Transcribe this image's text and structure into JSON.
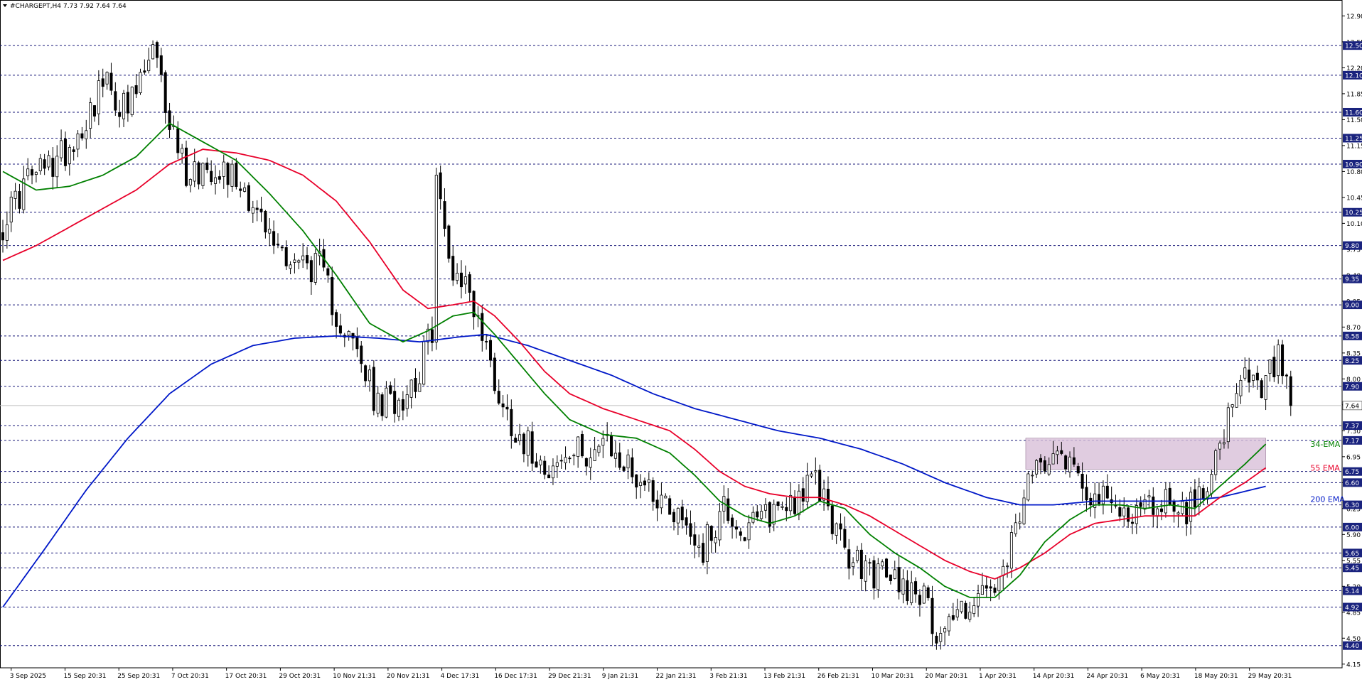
{
  "header": {
    "symbol": "#CHARGEPT,H4",
    "ohlc": "7.73 7.92 7.64 7.64",
    "arrow": "triangle-down-icon"
  },
  "colors": {
    "candle": "#000000",
    "ema34": "#008000",
    "ema55": "#e8002a",
    "ema200": "#0018c8",
    "level_line": "#1a1a7a",
    "level_tag_bg": "#1a237e",
    "level_tag_text": "#ffffff",
    "zone_fill": "#d8bfd8",
    "zone_border": "#8a6a8a",
    "current_price_line": "#c0c0c0"
  },
  "chart_data": {
    "type": "candlestick",
    "title": "#CHARGEPT,H4",
    "ylim": [
      4.1,
      13.0
    ],
    "grid": false,
    "price_ticks": [
      "12.90",
      "12.55",
      "12.20",
      "11.85",
      "11.50",
      "11.15",
      "10.80",
      "10.45",
      "10.10",
      "9.75",
      "9.40",
      "9.05",
      "8.70",
      "8.35",
      "8.00",
      "7.65",
      "7.30",
      "6.95",
      "6.60",
      "6.25",
      "5.90",
      "5.55",
      "5.20",
      "4.85",
      "4.50",
      "4.15"
    ],
    "levels": [
      "12.50",
      "12.10",
      "11.60",
      "11.25",
      "10.90",
      "10.25",
      "9.80",
      "9.35",
      "9.00",
      "8.58",
      "8.25",
      "7.90",
      "7.37",
      "7.17",
      "6.75",
      "6.60",
      "6.30",
      "6.00",
      "5.65",
      "5.45",
      "5.14",
      "4.92",
      "4.40"
    ],
    "current_price": "7.64",
    "x_labels": [
      "3 Sep 2025",
      "15 Sep 20:31",
      "25 Sep 20:31",
      "7 Oct 20:31",
      "17 Oct 20:31",
      "29 Oct 20:31",
      "10 Nov 21:31",
      "20 Nov 21:31",
      "4 Dec 17:31",
      "16 Dec 17:31",
      "29 Dec 21:31",
      "9 Jan 21:31",
      "22 Jan 21:31",
      "3 Feb 21:31",
      "13 Feb 21:31",
      "26 Feb 21:31",
      "10 Mar 20:31",
      "20 Mar 20:31",
      "1 Apr 20:31",
      "14 Apr 20:31",
      "24 Apr 20:31",
      "6 May 20:31",
      "18 May 20:31",
      "29 May 20:31"
    ],
    "zone": {
      "from_label": "14 Apr 20:31",
      "y_low": 6.78,
      "y_high": 7.2
    },
    "ema_labels": [
      {
        "text": "34-EMA",
        "series": "ema34"
      },
      {
        "text": "55 EMA",
        "series": "ema55"
      },
      {
        "text": "200 EMA",
        "series": "ema200"
      }
    ],
    "close_path": [
      [
        0,
        10.1
      ],
      [
        6,
        10.7
      ],
      [
        12,
        10.9
      ],
      [
        18,
        11.3
      ],
      [
        24,
        12.0
      ],
      [
        30,
        11.6
      ],
      [
        36,
        12.4
      ],
      [
        40,
        11.5
      ],
      [
        44,
        10.8
      ],
      [
        52,
        10.9
      ],
      [
        58,
        10.6
      ],
      [
        64,
        9.9
      ],
      [
        70,
        9.6
      ],
      [
        76,
        9.5
      ],
      [
        80,
        8.9
      ],
      [
        86,
        8.2
      ],
      [
        90,
        7.6
      ],
      [
        96,
        7.8
      ],
      [
        100,
        8.1
      ],
      [
        103,
        8.7
      ],
      [
        104,
        10.7
      ],
      [
        107,
        9.6
      ],
      [
        112,
        9.2
      ],
      [
        116,
        8.4
      ],
      [
        120,
        7.6
      ],
      [
        126,
        7.1
      ],
      [
        132,
        6.8
      ],
      [
        138,
        7.0
      ],
      [
        144,
        7.1
      ],
      [
        150,
        6.8
      ],
      [
        156,
        6.5
      ],
      [
        162,
        6.2
      ],
      [
        168,
        5.7
      ],
      [
        173,
        6.3
      ],
      [
        178,
        5.9
      ],
      [
        184,
        6.2
      ],
      [
        190,
        6.4
      ],
      [
        195,
        6.6
      ],
      [
        198,
        6.3
      ],
      [
        202,
        5.6
      ],
      [
        208,
        5.4
      ],
      [
        214,
        5.3
      ],
      [
        220,
        5.15
      ],
      [
        224,
        4.6
      ],
      [
        230,
        4.9
      ],
      [
        236,
        5.1
      ],
      [
        240,
        5.25
      ],
      [
        244,
        6.2
      ],
      [
        248,
        6.8
      ],
      [
        252,
        7.15
      ],
      [
        256,
        6.9
      ],
      [
        262,
        6.4
      ],
      [
        268,
        6.2
      ],
      [
        274,
        6.25
      ],
      [
        280,
        6.4
      ],
      [
        284,
        6.2
      ],
      [
        288,
        6.5
      ],
      [
        290,
        6.9
      ],
      [
        292,
        7.0
      ],
      [
        294,
        7.4
      ],
      [
        298,
        8.0
      ],
      [
        302,
        7.8
      ],
      [
        306,
        8.3
      ],
      [
        309,
        7.64
      ]
    ],
    "ema_anchors": {
      "ema34": [
        [
          0,
          10.8
        ],
        [
          8,
          10.55
        ],
        [
          16,
          10.6
        ],
        [
          24,
          10.75
        ],
        [
          32,
          11.0
        ],
        [
          40,
          11.45
        ],
        [
          48,
          11.2
        ],
        [
          56,
          10.95
        ],
        [
          64,
          10.5
        ],
        [
          72,
          10.0
        ],
        [
          80,
          9.4
        ],
        [
          88,
          8.75
        ],
        [
          96,
          8.5
        ],
        [
          102,
          8.65
        ],
        [
          108,
          8.85
        ],
        [
          113,
          8.9
        ],
        [
          118,
          8.6
        ],
        [
          124,
          8.2
        ],
        [
          130,
          7.8
        ],
        [
          136,
          7.45
        ],
        [
          144,
          7.25
        ],
        [
          152,
          7.2
        ],
        [
          160,
          7.0
        ],
        [
          166,
          6.7
        ],
        [
          172,
          6.35
        ],
        [
          178,
          6.15
        ],
        [
          184,
          6.05
        ],
        [
          190,
          6.15
        ],
        [
          196,
          6.35
        ],
        [
          202,
          6.25
        ],
        [
          208,
          5.9
        ],
        [
          214,
          5.65
        ],
        [
          220,
          5.45
        ],
        [
          226,
          5.2
        ],
        [
          232,
          5.05
        ],
        [
          238,
          5.05
        ],
        [
          244,
          5.35
        ],
        [
          250,
          5.8
        ],
        [
          256,
          6.1
        ],
        [
          262,
          6.3
        ],
        [
          268,
          6.3
        ],
        [
          274,
          6.25
        ],
        [
          280,
          6.3
        ],
        [
          286,
          6.25
        ],
        [
          292,
          6.55
        ],
        [
          298,
          6.85
        ],
        [
          303,
          7.12
        ]
      ],
      "ema55": [
        [
          0,
          9.6
        ],
        [
          8,
          9.8
        ],
        [
          16,
          10.05
        ],
        [
          24,
          10.3
        ],
        [
          32,
          10.55
        ],
        [
          40,
          10.9
        ],
        [
          48,
          11.1
        ],
        [
          56,
          11.05
        ],
        [
          64,
          10.95
        ],
        [
          72,
          10.75
        ],
        [
          80,
          10.4
        ],
        [
          88,
          9.85
        ],
        [
          96,
          9.2
        ],
        [
          102,
          8.95
        ],
        [
          108,
          9.0
        ],
        [
          113,
          9.05
        ],
        [
          118,
          8.85
        ],
        [
          124,
          8.5
        ],
        [
          130,
          8.1
        ],
        [
          136,
          7.8
        ],
        [
          144,
          7.6
        ],
        [
          152,
          7.45
        ],
        [
          160,
          7.3
        ],
        [
          166,
          7.05
        ],
        [
          172,
          6.75
        ],
        [
          178,
          6.55
        ],
        [
          184,
          6.45
        ],
        [
          190,
          6.4
        ],
        [
          196,
          6.4
        ],
        [
          202,
          6.3
        ],
        [
          208,
          6.15
        ],
        [
          214,
          5.95
        ],
        [
          220,
          5.75
        ],
        [
          226,
          5.55
        ],
        [
          232,
          5.4
        ],
        [
          238,
          5.3
        ],
        [
          244,
          5.45
        ],
        [
          250,
          5.65
        ],
        [
          256,
          5.9
        ],
        [
          262,
          6.05
        ],
        [
          268,
          6.1
        ],
        [
          274,
          6.15
        ],
        [
          280,
          6.15
        ],
        [
          286,
          6.15
        ],
        [
          292,
          6.4
        ],
        [
          298,
          6.6
        ],
        [
          303,
          6.8
        ]
      ],
      "ema200": [
        [
          0,
          4.92
        ],
        [
          10,
          5.7
        ],
        [
          20,
          6.5
        ],
        [
          30,
          7.2
        ],
        [
          40,
          7.8
        ],
        [
          50,
          8.2
        ],
        [
          60,
          8.45
        ],
        [
          70,
          8.55
        ],
        [
          80,
          8.58
        ],
        [
          90,
          8.55
        ],
        [
          100,
          8.5
        ],
        [
          110,
          8.57
        ],
        [
          116,
          8.6
        ],
        [
          126,
          8.45
        ],
        [
          136,
          8.25
        ],
        [
          146,
          8.05
        ],
        [
          156,
          7.8
        ],
        [
          166,
          7.6
        ],
        [
          176,
          7.45
        ],
        [
          186,
          7.3
        ],
        [
          196,
          7.2
        ],
        [
          206,
          7.05
        ],
        [
          216,
          6.85
        ],
        [
          226,
          6.6
        ],
        [
          236,
          6.4
        ],
        [
          244,
          6.3
        ],
        [
          252,
          6.3
        ],
        [
          262,
          6.35
        ],
        [
          272,
          6.35
        ],
        [
          282,
          6.35
        ],
        [
          292,
          6.4
        ],
        [
          303,
          6.55
        ]
      ]
    }
  }
}
